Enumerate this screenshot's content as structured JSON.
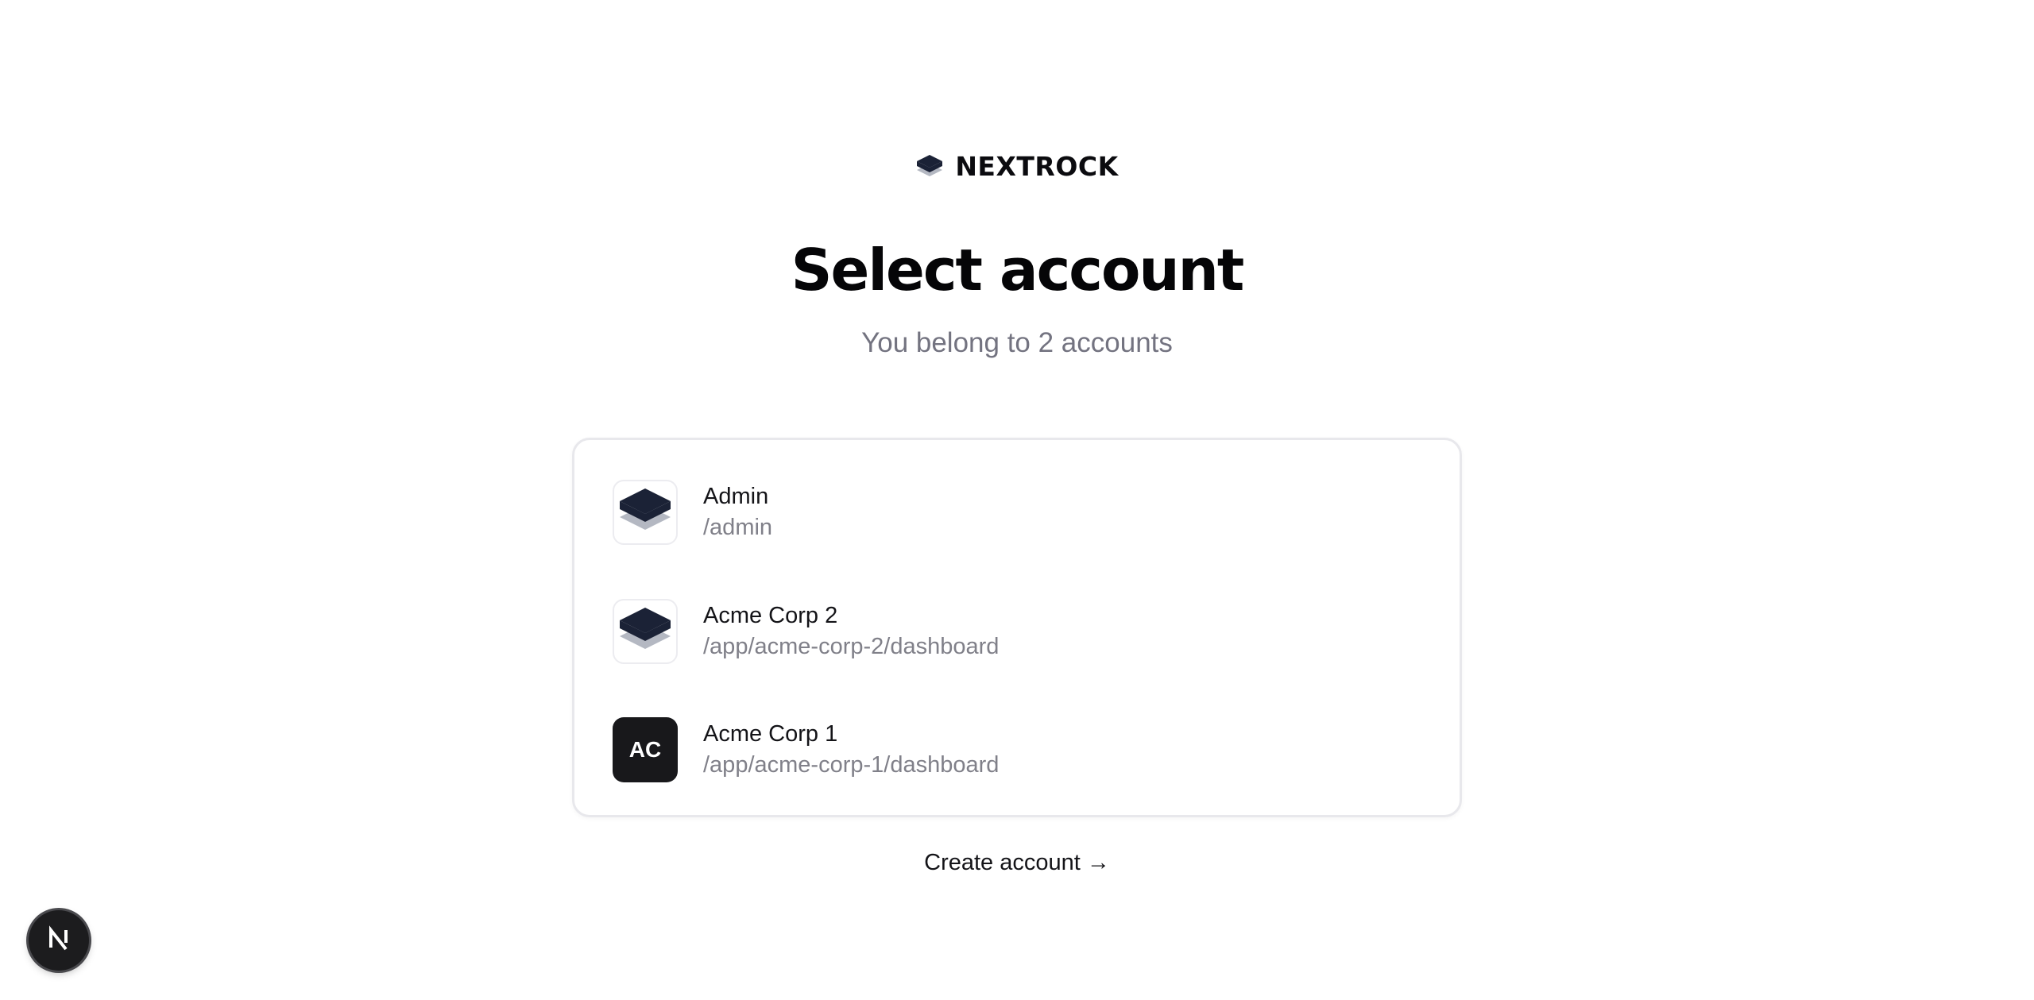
{
  "brand": {
    "name": "NEXTROCK",
    "logo_icon": "layers-icon"
  },
  "heading": {
    "title": "Select account",
    "subtitle": "You belong to 2 accounts"
  },
  "accounts": [
    {
      "name": "Admin",
      "path": "/admin",
      "avatar_icon": "layers-icon"
    },
    {
      "name": "Acme Corp 2",
      "path": "/app/acme-corp-2/dashboard",
      "avatar_icon": "layers-icon"
    },
    {
      "name": "Acme Corp 1",
      "path": "/app/acme-corp-1/dashboard",
      "avatar_initials": "AC"
    }
  ],
  "create_account": {
    "label": "Create account →"
  },
  "dev_badge": {
    "letter": "N",
    "icon": "nextjs-icon"
  },
  "colors": {
    "logo_dark": "#1b2236",
    "logo_light": "#b4b8c2",
    "initials_bg": "#18181b",
    "muted_text": "#737380"
  }
}
